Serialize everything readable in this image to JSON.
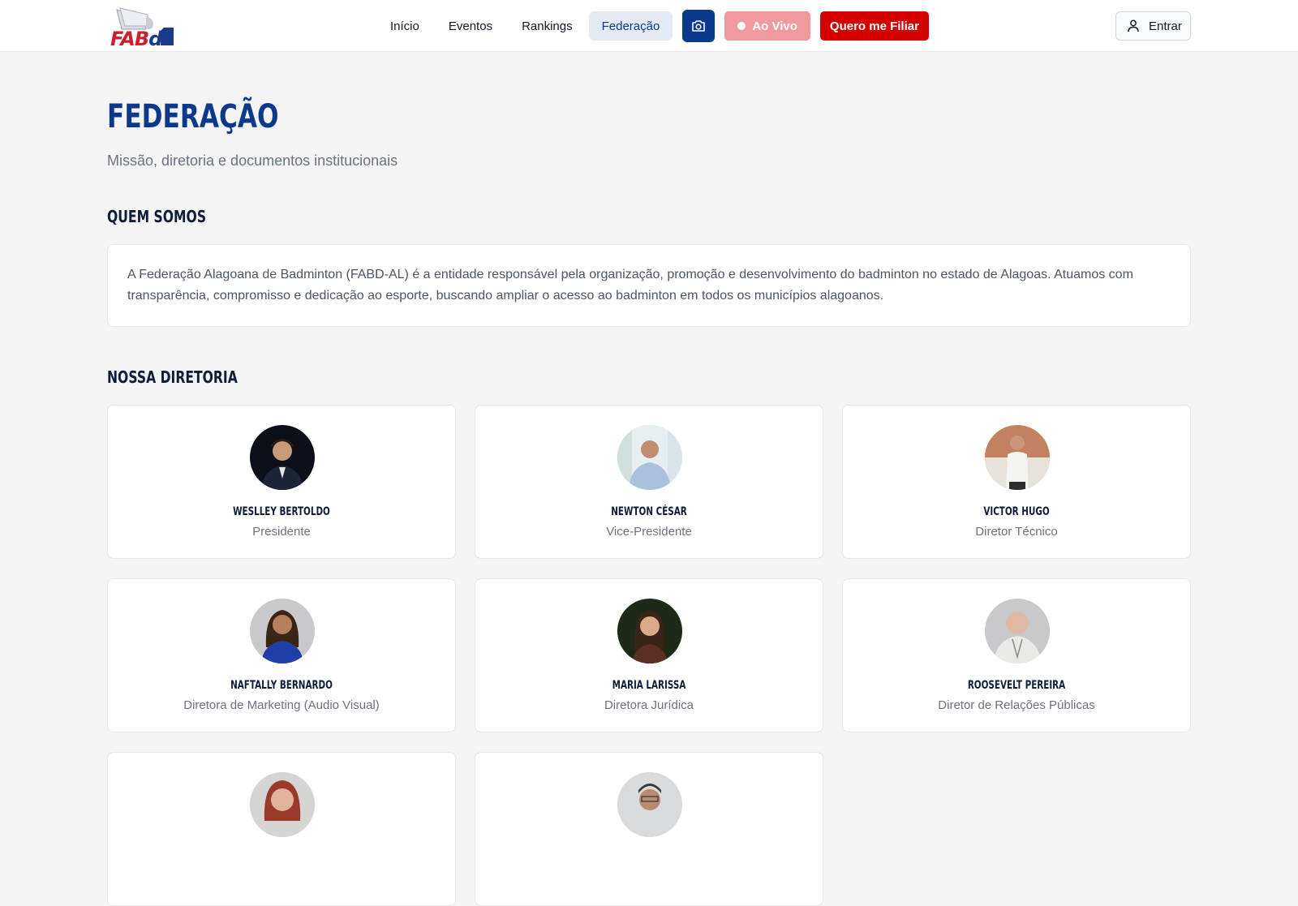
{
  "header": {
    "logo_text_prefix": "FAB",
    "logo_text_suffix": "d",
    "nav": [
      {
        "label": "Início",
        "active": false
      },
      {
        "label": "Eventos",
        "active": false
      },
      {
        "label": "Rankings",
        "active": false
      },
      {
        "label": "Federação",
        "active": true
      }
    ],
    "camera_icon": "camera-icon",
    "live_label": "Ao Vivo",
    "join_label": "Quero me Filiar",
    "login_label": "Entrar",
    "login_icon": "user-icon"
  },
  "page": {
    "title": "FEDERAÇÃO",
    "subtitle": "Missão, diretoria e documentos institucionais"
  },
  "about": {
    "heading": "QUEM SOMOS",
    "text": "A Federação Alagoana de Badminton (FABD-AL) é a entidade responsável pela organização, promoção e desenvolvimento do badminton no estado de Alagoas. Atuamos com transparência, compromisso e dedicação ao esporte, buscando ampliar o acesso ao badminton em todos os municípios alagoanos."
  },
  "board": {
    "heading": "NOSSA DIRETORIA",
    "members": [
      {
        "name": "WESLLEY BERTOLDO",
        "role": "Presidente"
      },
      {
        "name": "NEWTON CÉSAR",
        "role": "Vice-Presidente"
      },
      {
        "name": "VICTOR HUGO",
        "role": "Diretor Técnico"
      },
      {
        "name": "NAFTALLY BERNARDO",
        "role": "Diretora de Marketing (Audio Visual)"
      },
      {
        "name": "MARIA LARISSA",
        "role": "Diretora Jurídica"
      },
      {
        "name": "ROOSEVELT PEREIRA",
        "role": "Diretor de Relações Públicas"
      },
      {
        "name": "",
        "role": ""
      },
      {
        "name": "",
        "role": ""
      }
    ]
  },
  "colors": {
    "brand_blue": "#0b3a8c",
    "brand_red": "#d40000",
    "live_pink": "#f09aa0"
  }
}
